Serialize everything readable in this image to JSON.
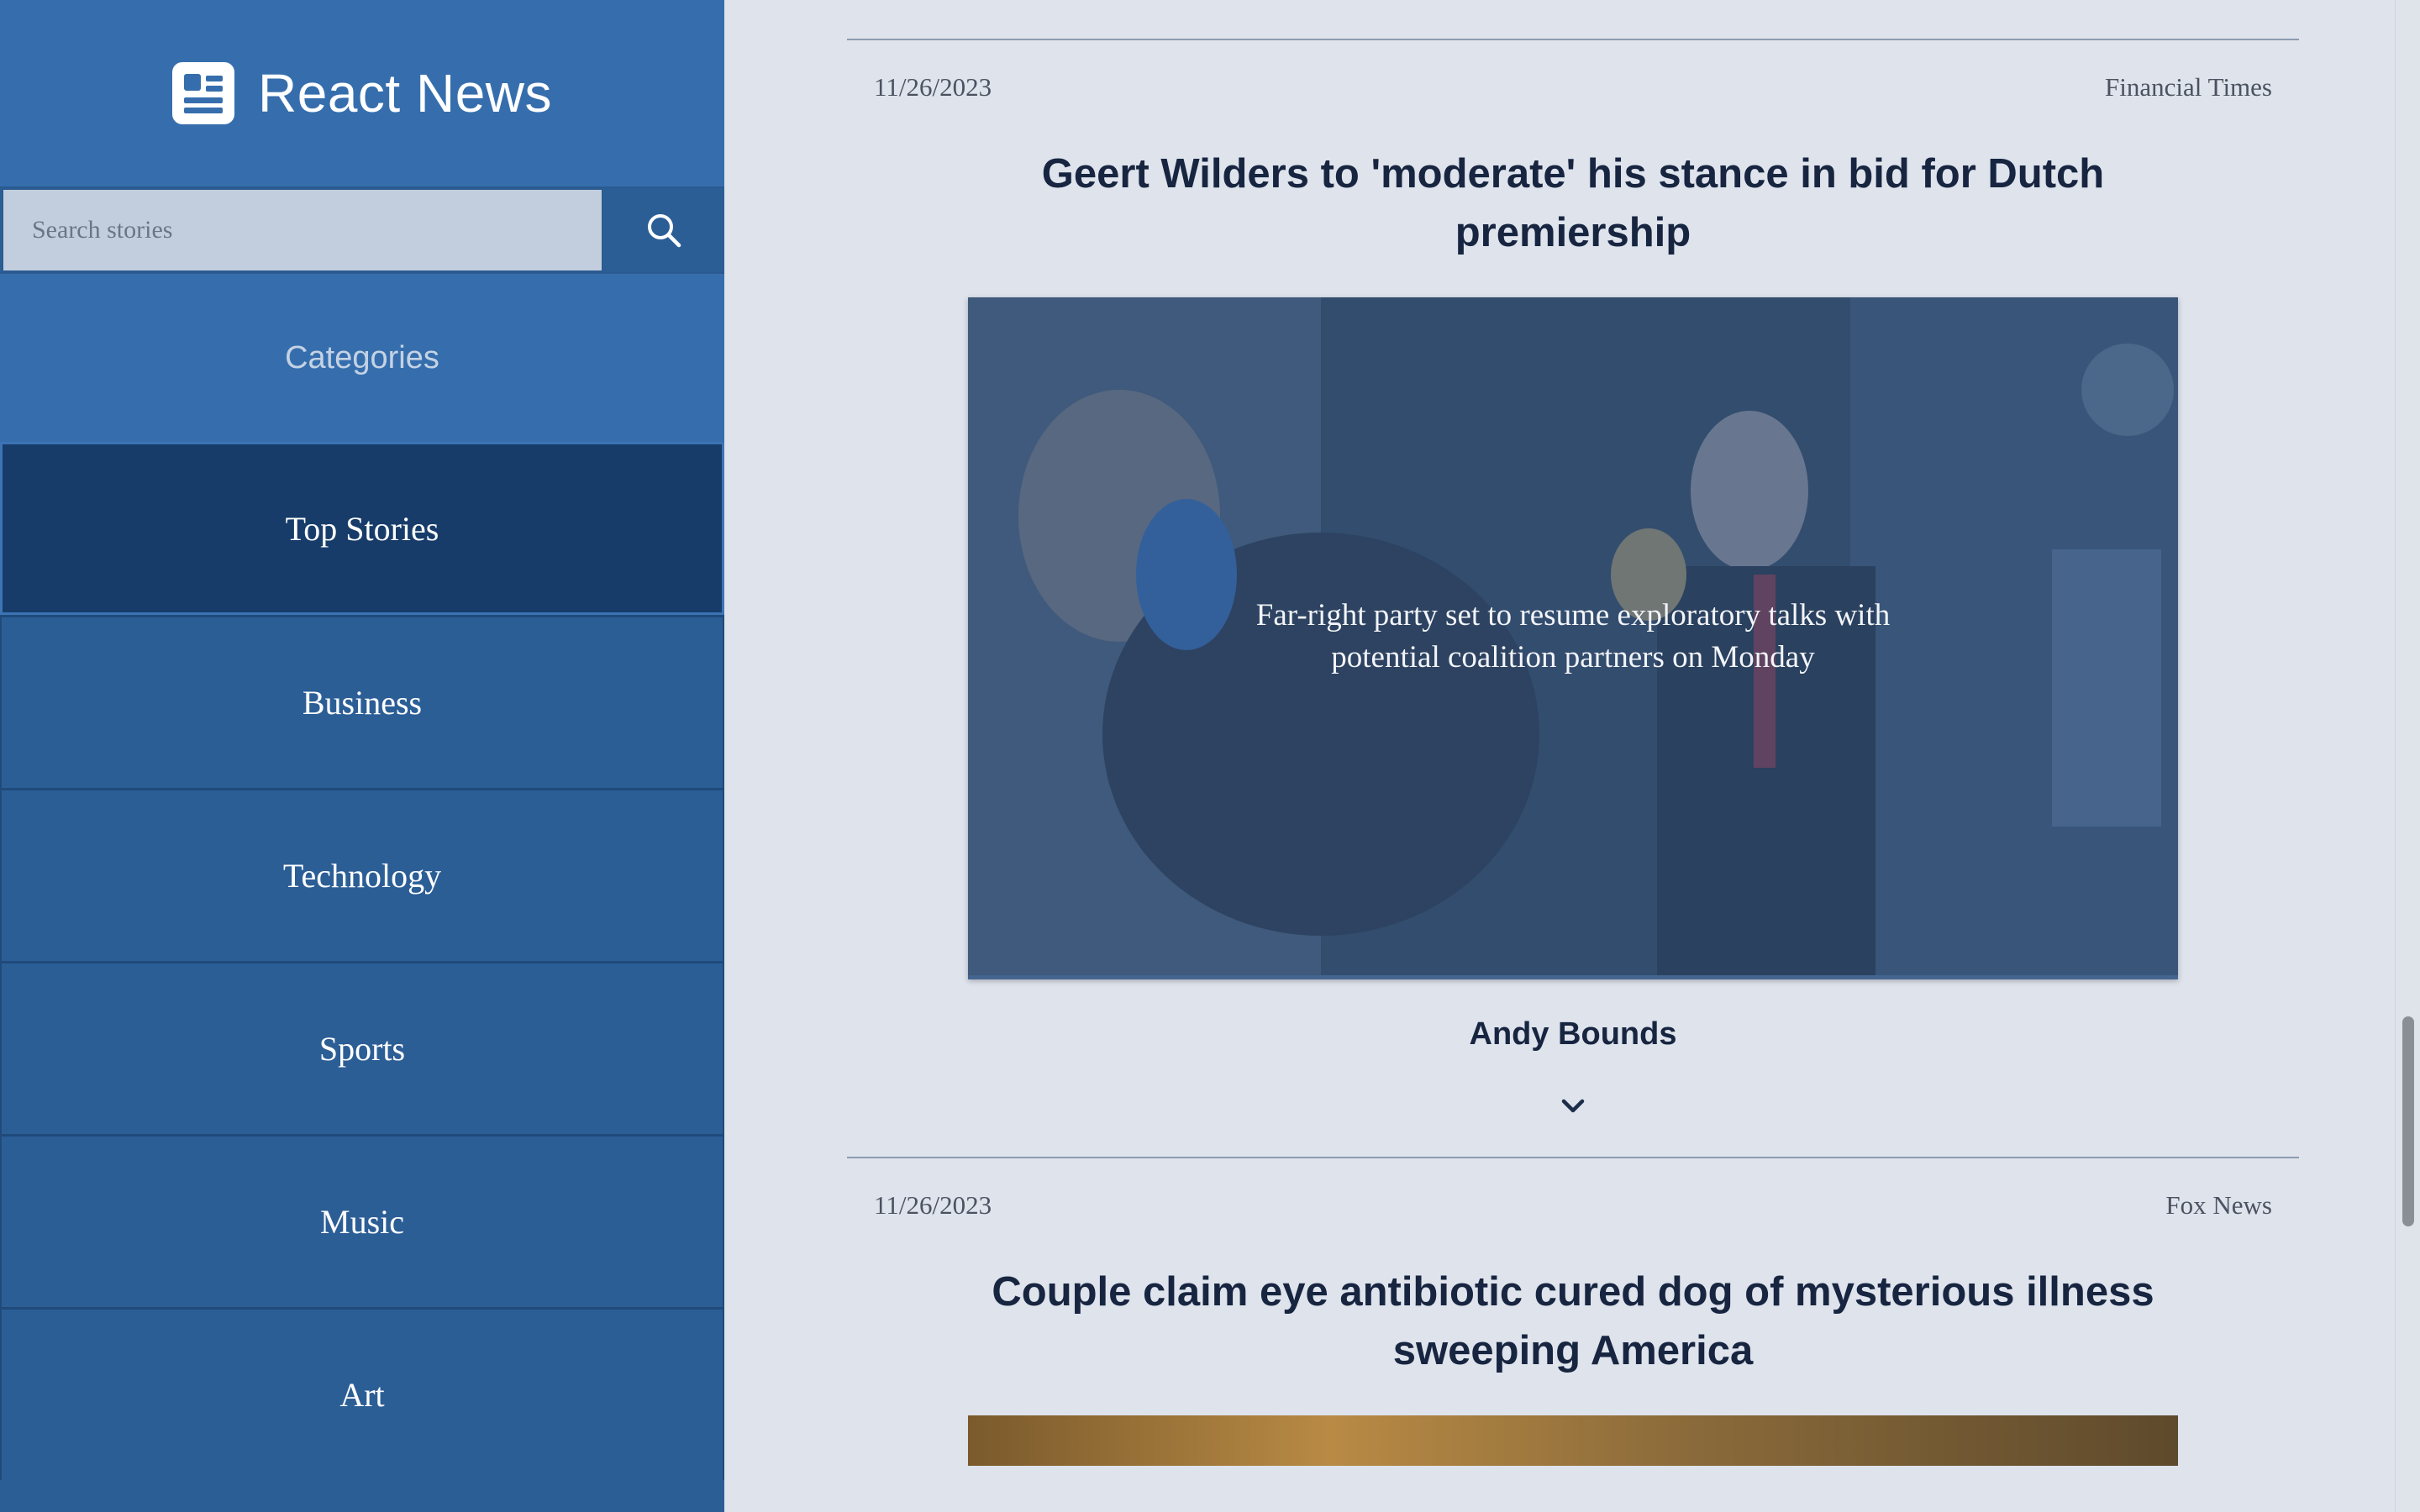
{
  "app": {
    "title": "React News",
    "logo_icon": "newspaper-icon"
  },
  "search": {
    "placeholder": "Search stories",
    "icon": "search-icon"
  },
  "sidebar": {
    "categories_label": "Categories",
    "items": [
      {
        "label": "Top Stories",
        "active": true
      },
      {
        "label": "Business",
        "active": false
      },
      {
        "label": "Technology",
        "active": false
      },
      {
        "label": "Sports",
        "active": false
      },
      {
        "label": "Music",
        "active": false
      },
      {
        "label": "Art",
        "active": false
      }
    ]
  },
  "articles": [
    {
      "date": "11/26/2023",
      "source": "Financial Times",
      "headline": "Geert Wilders to 'moderate' his stance in bid for Dutch premiership",
      "caption": "Far-right party set to resume exploratory talks with potential coalition partners on Monday",
      "author": "Andy Bounds",
      "expand_icon": "chevron-down-icon"
    },
    {
      "date": "11/26/2023",
      "source": "Fox News",
      "headline": "Couple claim eye antibiotic cured dog of mysterious illness sweeping America"
    }
  ],
  "colors": {
    "sidebar": "#2c5e96",
    "sidebar_header": "#366ead",
    "active_item": "#173c6a",
    "page_background": "#dee3ec",
    "headline_text": "#172540"
  }
}
